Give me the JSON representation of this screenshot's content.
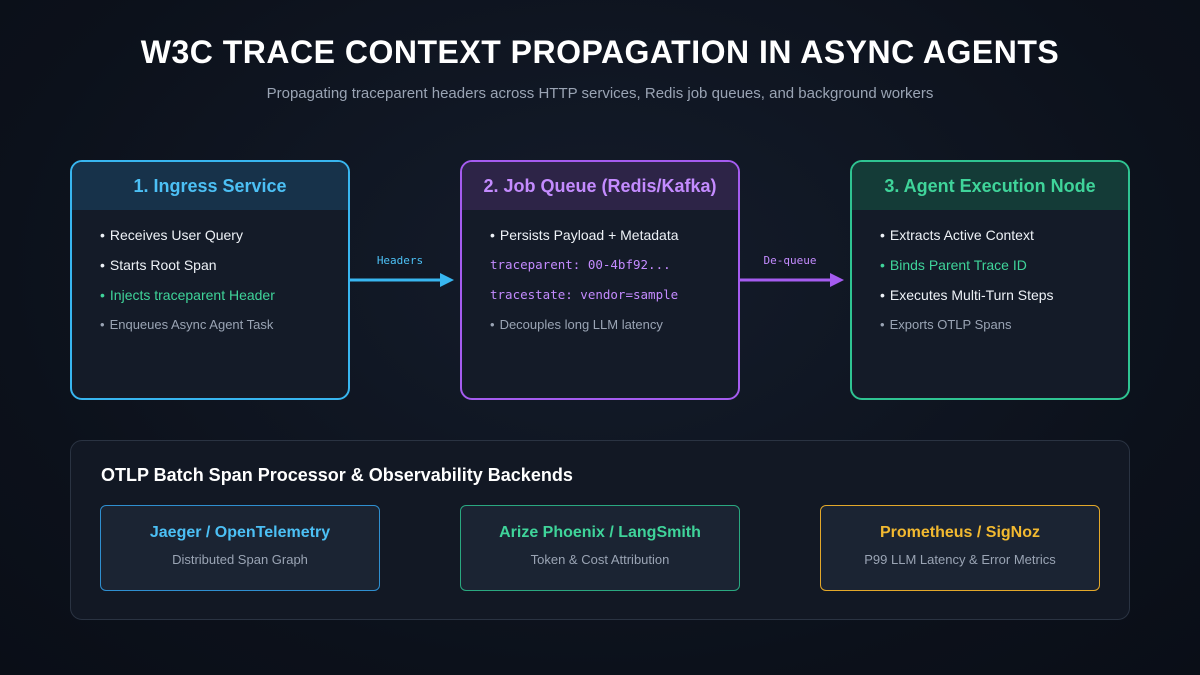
{
  "header": {
    "title": "W3C TRACE CONTEXT PROPAGATION IN ASYNC AGENTS",
    "subtitle": "Propagating traceparent headers across HTTP services, Redis job queues, and background workers"
  },
  "stages": [
    {
      "title": "1. Ingress Service",
      "color": "#38b6f0",
      "items": [
        {
          "bullet": "•",
          "text": "Receives User Query"
        },
        {
          "bullet": "•",
          "text": "Starts Root Span"
        },
        {
          "bullet": "•",
          "text": "Injects traceparent Header"
        },
        {
          "bullet": "•",
          "text": "Enqueues Async Agent Task"
        }
      ]
    },
    {
      "title": "2. Job Queue (Redis/Kafka)",
      "color": "#a55cf0",
      "items": [
        {
          "bullet": "•",
          "text": "Persists Payload + Metadata"
        },
        {
          "text": "traceparent: 00-4bf92..."
        },
        {
          "text": "tracestate: vendor=sample"
        },
        {
          "bullet": "•",
          "text": "Decouples long LLM latency"
        }
      ]
    },
    {
      "title": "3. Agent Execution Node",
      "color": "#2fc492",
      "items": [
        {
          "bullet": "•",
          "text": "Extracts Active Context"
        },
        {
          "bullet": "•",
          "text": "Binds Parent Trace ID"
        },
        {
          "bullet": "•",
          "text": "Executes Multi-Turn Steps"
        },
        {
          "bullet": "•",
          "text": "Exports OTLP Spans"
        }
      ]
    }
  ],
  "arrows": [
    {
      "label": "Headers",
      "color": "#38b6f0"
    },
    {
      "label": "De-queue",
      "color": "#a55cf0"
    }
  ],
  "backends_panel": {
    "title": "OTLP Batch Span Processor & Observability Backends",
    "backends": [
      {
        "name": "Jaeger / OpenTelemetry",
        "description": "Distributed Span Graph",
        "color": "#4cc0f5"
      },
      {
        "name": "Arize Phoenix / LangSmith",
        "description": "Token & Cost Attribution",
        "color": "#3fd49a"
      },
      {
        "name": "Prometheus / SigNoz",
        "description": "P99 LLM Latency & Error Metrics",
        "color": "#f2b930"
      }
    ]
  }
}
